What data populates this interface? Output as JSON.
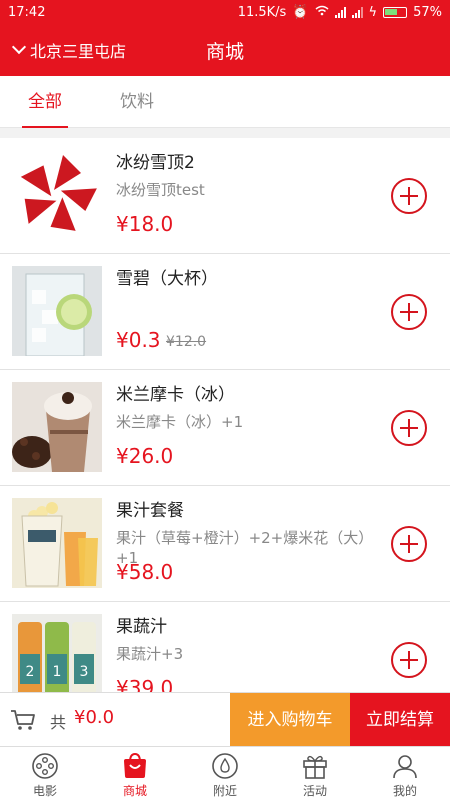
{
  "status_bar": {
    "time": "17:42",
    "network_speed": "11.5K/s",
    "battery": "57%"
  },
  "header": {
    "store_name": "北京三里屯店",
    "title": "商城"
  },
  "tabs": [
    {
      "label": "全部",
      "active": true
    },
    {
      "label": "饮料",
      "active": false
    }
  ],
  "products": [
    {
      "name": "冰纷雪顶2",
      "desc": "冰纷雪顶test",
      "price": "¥18.0",
      "old_price": ""
    },
    {
      "name": "雪碧（大杯）",
      "desc": "",
      "price": "¥0.3",
      "old_price": "¥12.0"
    },
    {
      "name": "米兰摩卡（冰）",
      "desc": "米兰摩卡（冰）+1",
      "price": "¥26.0",
      "old_price": ""
    },
    {
      "name": "果汁套餐",
      "desc": "果汁（草莓+橙汁）+2+爆米花（大）+1",
      "price": "¥58.0",
      "old_price": ""
    },
    {
      "name": "果蔬汁",
      "desc": "果蔬汁+3",
      "price": "¥39.0",
      "old_price": ""
    }
  ],
  "cart_bar": {
    "total_label": "共",
    "total_amount": "¥0.0",
    "cart_button": "进入购物车",
    "checkout_button": "立即结算"
  },
  "bottom_nav": [
    {
      "label": "电影",
      "icon": "film-reel-icon",
      "active": false
    },
    {
      "label": "商城",
      "icon": "shopping-bag-icon",
      "active": true
    },
    {
      "label": "附近",
      "icon": "location-pin-icon",
      "active": false
    },
    {
      "label": "活动",
      "icon": "gift-icon",
      "active": false
    },
    {
      "label": "我的",
      "icon": "user-icon",
      "active": false
    }
  ],
  "colors": {
    "brand_red": "#e5141f",
    "cart_orange": "#f39a2b",
    "text_gray": "#888888"
  }
}
